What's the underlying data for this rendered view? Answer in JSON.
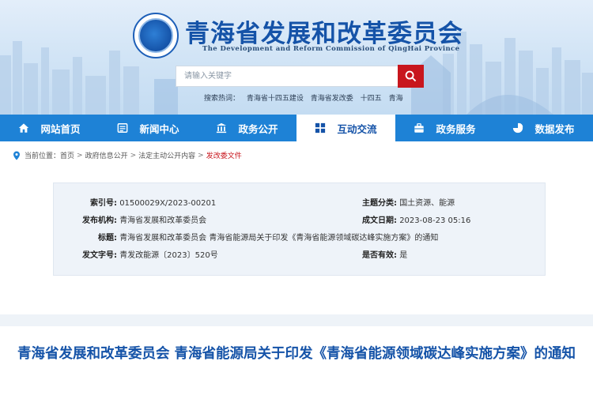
{
  "header": {
    "title": "青海省发展和改革委员会",
    "subtitle": "The Development and Reform Commission of QingHai Province",
    "search_placeholder": "请输入关键字",
    "hot_search_label": "搜索热词：",
    "hot_terms": [
      "青海省十四五建设",
      "青海省发改委",
      "十四五",
      "青海"
    ]
  },
  "nav": {
    "items": [
      {
        "label": "网站首页",
        "icon": "home-icon"
      },
      {
        "label": "新闻中心",
        "icon": "news-icon"
      },
      {
        "label": "政务公开",
        "icon": "open-gov-icon"
      },
      {
        "label": "互动交流",
        "icon": "interact-icon"
      },
      {
        "label": "政务服务",
        "icon": "service-icon"
      },
      {
        "label": "数据发布",
        "icon": "chart-icon"
      }
    ],
    "active": "互动交流"
  },
  "breadcrumb": {
    "label": "当前位置：",
    "items": [
      "首页",
      "政府信息公开",
      "法定主动公开内容"
    ],
    "current": "发改委文件",
    "separator": ">"
  },
  "meta": {
    "index_no_label": "索引号:",
    "index_no": "01500029X/2023-00201",
    "topic_label": "主题分类:",
    "topic": "国土资源、能源",
    "publisher_label": "发布机构:",
    "publisher": "青海省发展和改革委员会",
    "date_label": "成文日期:",
    "date": "2023-08-23 05:16",
    "title_label": "标题:",
    "title": "青海省发展和改革委员会 青海省能源局关于印发《青海省能源领域碳达峰实施方案》的通知",
    "doc_no_label": "发文字号:",
    "doc_no": "青发改能源〔2023〕520号",
    "valid_label": "是否有效:",
    "valid": "是"
  },
  "article": {
    "title": "青海省发展和改革委员会 青海省能源局关于印发《青海省能源领域碳达峰实施方案》的通知"
  },
  "colors": {
    "primary_blue": "#1553a8",
    "nav_blue": "#1e82d6",
    "search_red": "#c8161d",
    "breadcrumb_current": "#c8161d"
  }
}
